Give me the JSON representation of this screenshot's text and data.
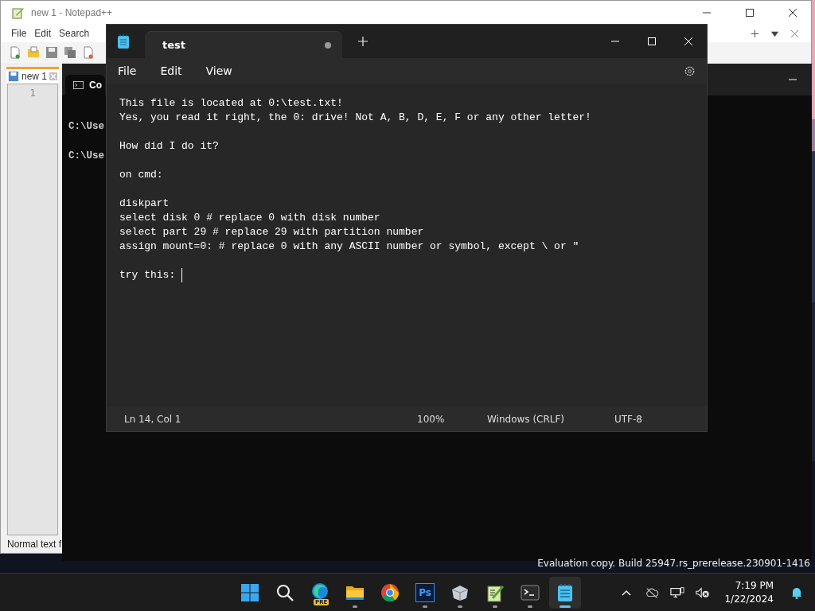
{
  "desktop": {
    "watermark": "Evaluation copy. Build 25947.rs_prerelease.230901-1416"
  },
  "notepad_plus_plus": {
    "title": "new 1 - Notepad++",
    "menu": [
      "File",
      "Edit",
      "Search"
    ],
    "tabs": [
      {
        "label": "new 1",
        "selected": true
      }
    ],
    "line_numbers": [
      "1"
    ],
    "status": "Normal text f"
  },
  "terminal": {
    "tab_label": "Co",
    "lines": [
      "C:\\Use",
      "C:\\Use"
    ]
  },
  "notepad": {
    "tabs": [
      {
        "label": "test",
        "selected": true,
        "modified": true
      }
    ],
    "menu": [
      "File",
      "Edit",
      "View"
    ],
    "blocks": [
      [
        "This file is located at 0:\\test.txt!",
        "Yes, you read it right, the 0: drive! Not A, B, D, E, F or any other letter!"
      ],
      [
        "How did I do it?"
      ],
      [
        "on cmd:"
      ],
      [
        "diskpart",
        "select disk 0 # replace 0 with disk number",
        "select part 29 # replace 29 with partition number",
        "assign mount=0: # replace 0 with any ASCII number or symbol, except \\ or \""
      ],
      [
        "try this: "
      ]
    ],
    "caret": true,
    "status": {
      "position": "Ln 14, Col 1",
      "zoom": "100%",
      "line_ending": "Windows (CRLF)",
      "encoding": "UTF-8"
    }
  },
  "taskbar": {
    "apps": [
      {
        "kind": "start",
        "running": false,
        "active": false
      },
      {
        "kind": "search",
        "running": false,
        "active": false
      },
      {
        "kind": "edge",
        "badge": "PRE",
        "running": false,
        "active": false
      },
      {
        "kind": "folder",
        "running": true,
        "active": false
      },
      {
        "kind": "chrome",
        "running": false,
        "active": false
      },
      {
        "kind": "ps",
        "label": "Ps",
        "running": true,
        "active": false
      },
      {
        "kind": "cube",
        "running": true,
        "active": false
      },
      {
        "kind": "npp",
        "running": true,
        "active": false
      },
      {
        "kind": "terminal",
        "running": true,
        "active": false
      },
      {
        "kind": "notepad",
        "running": true,
        "active": true
      }
    ],
    "time": "7:19 PM",
    "date": "1/22/2024"
  }
}
